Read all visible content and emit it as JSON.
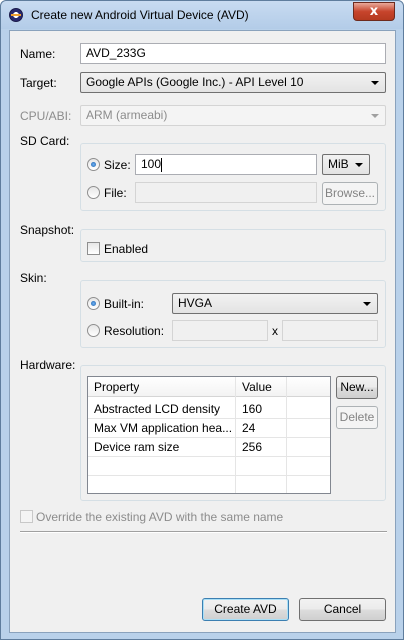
{
  "window": {
    "title": "Create new Android Virtual Device (AVD)",
    "close_label": "x"
  },
  "name": {
    "label": "Name:",
    "value": "AVD_233G"
  },
  "target": {
    "label": "Target:",
    "value": "Google APIs (Google Inc.) - API Level 10"
  },
  "cpu": {
    "label": "CPU/ABI:",
    "value": "ARM (armeabi)"
  },
  "sdcard": {
    "label": "SD Card:",
    "size_label": "Size:",
    "size_value": "100",
    "unit": "MiB",
    "file_label": "File:",
    "file_value": "",
    "browse_label": "Browse..."
  },
  "snapshot": {
    "label": "Snapshot:",
    "enabled_label": "Enabled"
  },
  "skin": {
    "label": "Skin:",
    "builtin_label": "Built-in:",
    "builtin_value": "HVGA",
    "resolution_label": "Resolution:",
    "x_label": "x"
  },
  "hardware": {
    "label": "Hardware:",
    "columns": [
      "Property",
      "Value"
    ],
    "rows": [
      {
        "property": "Abstracted LCD density",
        "value": "160"
      },
      {
        "property": "Max VM application hea...",
        "value": "24"
      },
      {
        "property": "Device ram size",
        "value": "256"
      }
    ],
    "new_label": "New...",
    "delete_label": "Delete"
  },
  "override": {
    "label": "Override the existing AVD with the same name"
  },
  "footer": {
    "create_label": "Create AVD",
    "cancel_label": "Cancel"
  },
  "colors": {
    "titlebar": "#b9d1ea",
    "close": "#c7442c",
    "dialog_bg": "#f0f0f0",
    "default_button_border": "#3c7fb1"
  }
}
